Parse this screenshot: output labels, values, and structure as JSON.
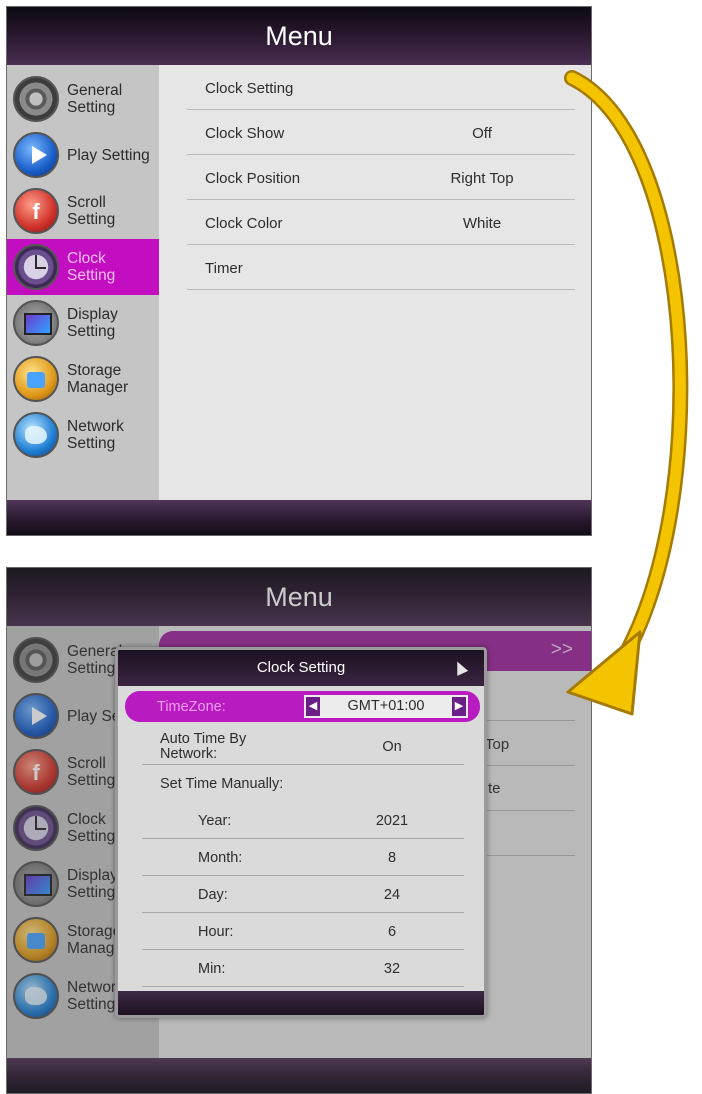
{
  "menu_title": "Menu",
  "sidebar": {
    "items": [
      {
        "label": "General Setting",
        "icon": "gear-icon"
      },
      {
        "label": "Play Setting",
        "icon": "play-icon"
      },
      {
        "label": "Scroll Setting",
        "icon": "scroll-icon"
      },
      {
        "label": "Clock Setting",
        "icon": "clock-icon"
      },
      {
        "label": "Display Setting",
        "icon": "display-icon"
      },
      {
        "label": "Storage Manager",
        "icon": "storage-icon"
      },
      {
        "label": "Network Setting",
        "icon": "network-icon"
      }
    ],
    "active_index": 3
  },
  "clock_menu": {
    "rows": [
      {
        "label": "Clock Setting",
        "value": ""
      },
      {
        "label": "Clock Show",
        "value": "Off"
      },
      {
        "label": "Clock Position",
        "value": "Right Top"
      },
      {
        "label": "Clock Color",
        "value": "White"
      },
      {
        "label": "Timer",
        "value": ""
      }
    ]
  },
  "background_peek": {
    "highlight_arrows": ">>",
    "fragment_top": "Top",
    "fragment_color": "te"
  },
  "dialog": {
    "title": "Clock Setting",
    "timezone": {
      "label": "TimeZone:",
      "value": "GMT+01:00"
    },
    "rows": [
      {
        "label": "Auto Time By Network:",
        "value": "On"
      },
      {
        "label": "Set Time Manually:",
        "value": ""
      },
      {
        "label": "Year:",
        "value": "2021"
      },
      {
        "label": "Month:",
        "value": "8"
      },
      {
        "label": "Day:",
        "value": "24"
      },
      {
        "label": "Hour:",
        "value": "6"
      },
      {
        "label": "Min:",
        "value": "32"
      }
    ]
  },
  "colors": {
    "active_magenta": "#c20ec0",
    "arrow_yellow": "#f5c400",
    "header_dark": "#1c1222"
  }
}
